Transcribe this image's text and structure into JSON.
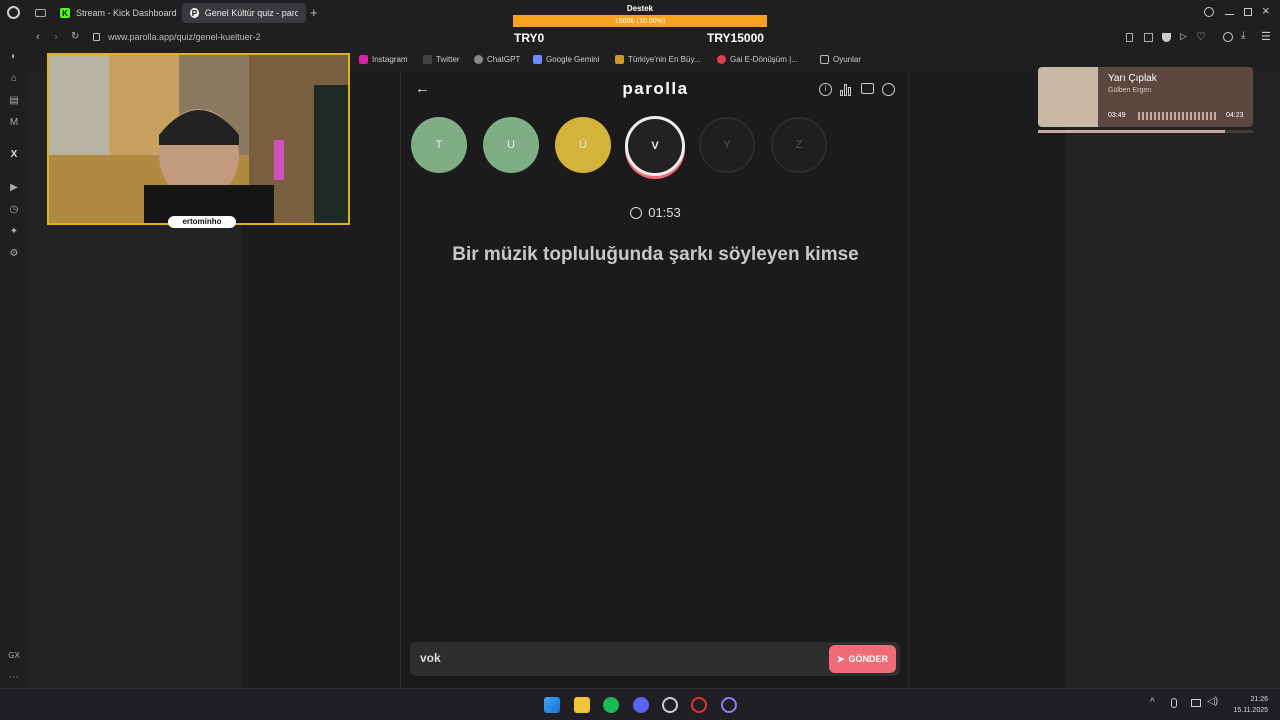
{
  "browser": {
    "tabs": [
      {
        "title": "Stream - Kick Dashboard",
        "active": false
      },
      {
        "title": "Genel Kültür quiz - paroll...",
        "active": true
      }
    ],
    "url": "www.parolla.app/quiz/genel-kueltuer-2",
    "bookmarks": [
      "Instagram",
      "Twitter",
      "ChatGPT",
      "Google Gemini",
      "Türkiye'nin En Büy...",
      "Gai E-Dönüşüm |...",
      "Oyunlar"
    ]
  },
  "donation": {
    "title": "Destek",
    "progress_text": "1500₺ (10.00%)",
    "progress_fraction": 0.1,
    "current": "TRY0",
    "goal": "TRY15000"
  },
  "webcam": {
    "name": "ertominho"
  },
  "quiz": {
    "logo": "parolla",
    "letters": [
      {
        "letter": "T",
        "state": "correct"
      },
      {
        "letter": "U",
        "state": "correct"
      },
      {
        "letter": "Ü",
        "state": "skipped"
      },
      {
        "letter": "V",
        "state": "current"
      },
      {
        "letter": "Y",
        "state": "pending"
      },
      {
        "letter": "Z",
        "state": "pending"
      }
    ],
    "timer": "01:53",
    "question": "Bir müzik topluluğunda şarkı söyleyen kimse",
    "answer_value": "vok",
    "send_label": "GÖNDER"
  },
  "music": {
    "song": "Yarı Çıplak",
    "artist": "Gülben Ergen",
    "current_time": "03:49",
    "total_time": "04:23",
    "progress_fraction": 0.87
  },
  "taskbar": {
    "time": "21:26",
    "date": "15.11.2025"
  },
  "colors": {
    "correct": "#7fae86",
    "skipped": "#d4b33a",
    "current_ring": "#ef6b7a",
    "accent": "#ef6b7a"
  }
}
